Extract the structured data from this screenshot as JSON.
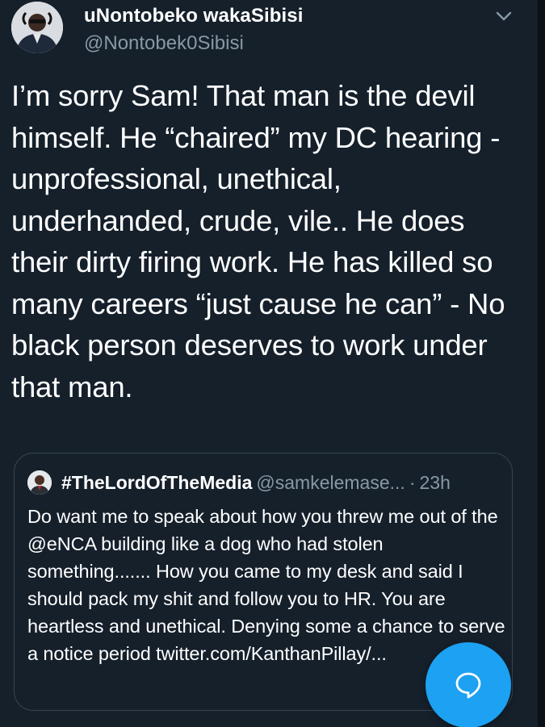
{
  "tweet": {
    "author": {
      "display_name": "uNontobeko wakaSibisi",
      "handle": "@Nontobek0Sibisi",
      "avatar_icon": "profile-photo"
    },
    "menu_icon": "chevron-down-icon",
    "text": "I’m sorry Sam! That man is the devil himself. He “chaired” my DC hearing - unprofessional, unethical, underhanded, crude, vile.. He does their dirty firing work. He has killed so many careers “just cause he can” - No black person deserves to work under that man."
  },
  "quoted_tweet": {
    "author": {
      "display_name": "#TheLordOfTheMedia",
      "handle": "@samkelemase...",
      "avatar_icon": "profile-photo"
    },
    "separator": "·",
    "time": "23h",
    "text": "Do want me to speak about how you threw me out of the @eNCA building like a dog who had stolen something....... How you came to my desk and said I should pack my shit and follow you to HR. You are heartless and unethical. Denying some a chance to serve a notice period twitter.com/KanthanPillay/..."
  },
  "compose_button": {
    "icon": "compose-reply-icon"
  },
  "colors": {
    "background": "#15202b",
    "primary_text": "#ffffff",
    "secondary_text": "#8899a6",
    "border": "#38444d",
    "accent": "#1da1f2"
  }
}
